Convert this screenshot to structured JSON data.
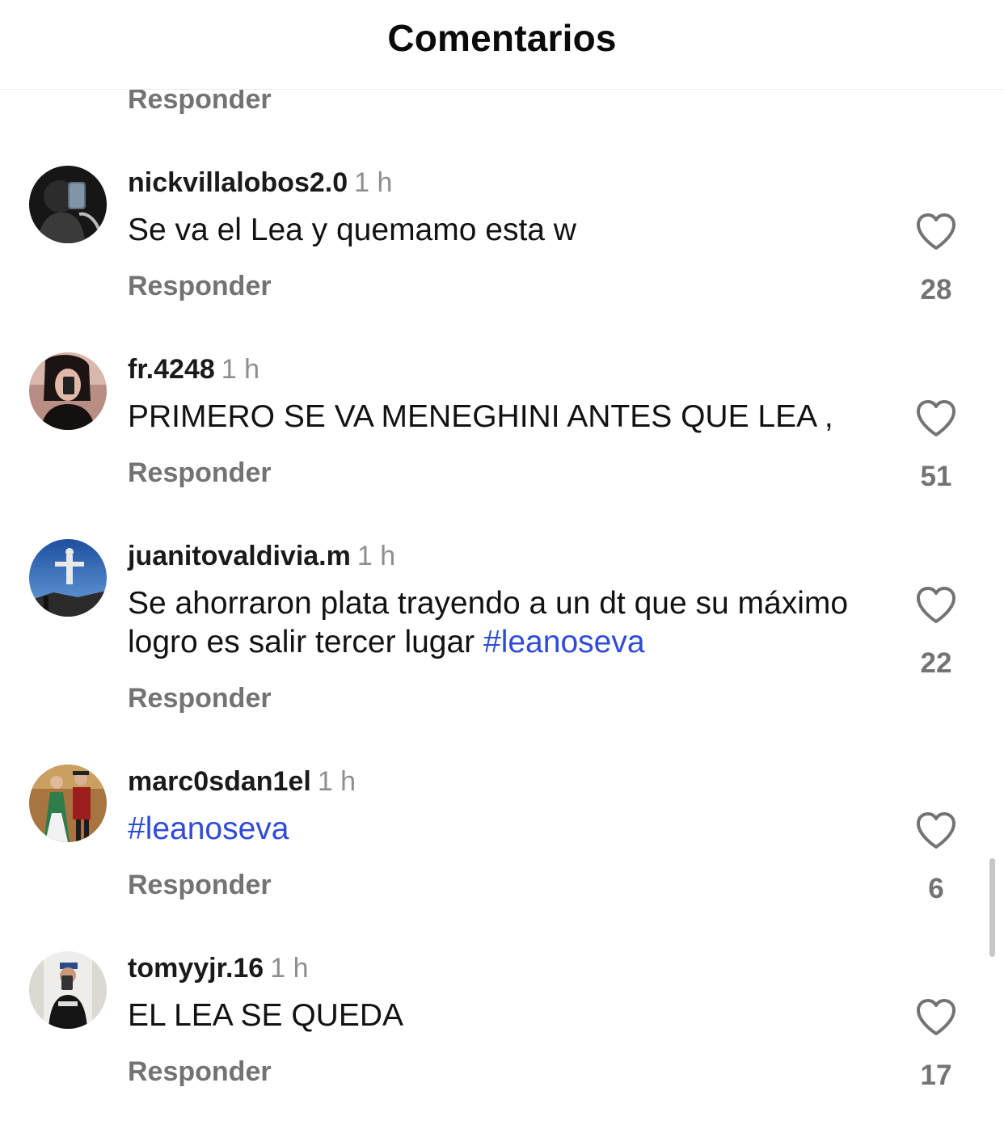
{
  "header": {
    "title": "Comentarios"
  },
  "top_reply_label": "Responder",
  "comments": [
    {
      "username": "nickvillalobos2.0",
      "time": "1 h",
      "text_parts": [
        {
          "t": "Se va el Lea y quemamo esta w"
        }
      ],
      "reply_label": "Responder",
      "likes": "28",
      "avatar_icon": "avatar-dark-mirror-selfie"
    },
    {
      "username": "fr.4248",
      "time": "1 h",
      "text_parts": [
        {
          "t": "PRIMERO SE VA MENEGHINI ANTES QUE LEA ,"
        }
      ],
      "reply_label": "Responder",
      "likes": "51",
      "avatar_icon": "avatar-selfie"
    },
    {
      "username": "juanitovaldivia.m",
      "time": "1 h",
      "text_parts": [
        {
          "t": "Se ahorraron plata trayendo a un dt que su máximo logro es salir tercer lugar "
        },
        {
          "t": "#leanoseva",
          "hashtag": true
        }
      ],
      "reply_label": "Responder",
      "likes": "22",
      "avatar_icon": "avatar-statue-sky"
    },
    {
      "username": "marc0sdan1el",
      "time": "1 h",
      "text_parts": [
        {
          "t": "#leanoseva",
          "hashtag": true
        }
      ],
      "reply_label": "Responder",
      "likes": "6",
      "avatar_icon": "avatar-couple-costumes"
    },
    {
      "username": "tomyyjr.16",
      "time": "1 h",
      "text_parts": [
        {
          "t": "EL LEA SE QUEDA"
        }
      ],
      "reply_label": "Responder",
      "likes": "17",
      "avatar_icon": "avatar-mirror-selfie-light"
    }
  ],
  "colors": {
    "hashtag": "#2f4bd8",
    "muted": "#737373",
    "time": "#8e8e8e"
  }
}
